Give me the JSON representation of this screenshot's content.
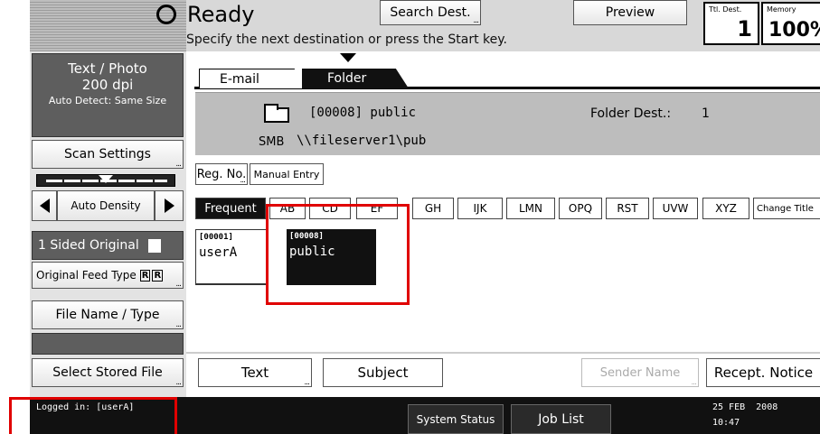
{
  "header": {
    "status_label": "Ready",
    "instruction": "Specify the next destination or press the Start key.",
    "search_dest_label": "Search Dest.",
    "preview_label": "Preview",
    "ttl_dest_label": "Ttl. Dest.",
    "ttl_dest_value": "1",
    "memory_label": "Memory",
    "memory_value": "100%"
  },
  "left_panel": {
    "mode_line1": "Text / Photo",
    "mode_line2": "200 dpi",
    "mode_line3": "Auto Detect: Same Size",
    "scan_settings": "Scan Settings",
    "density_label": "Auto Density",
    "original_sides": "1 Sided Original",
    "feed_type": "Original Feed Type",
    "file_name_type": "File Name / Type",
    "select_stored_file": "Select Stored File"
  },
  "tabs": [
    {
      "label": "E-mail",
      "active": false
    },
    {
      "label": "Folder",
      "active": true
    }
  ],
  "destination": {
    "folder_entry": "[00008] public",
    "protocol": "SMB",
    "path": "\\\\fileserver1\\pub",
    "folder_dest_label": "Folder Dest.:",
    "folder_dest_count": "1"
  },
  "entry_buttons": {
    "reg_no": "Reg. No.",
    "manual_entry": "Manual Entry"
  },
  "index_keys": [
    "Frequent",
    "AB",
    "CD",
    "EF",
    "GH",
    "IJK",
    "LMN",
    "OPQ",
    "RST",
    "UVW",
    "XYZ",
    "Change Title"
  ],
  "destinations": [
    {
      "number": "[00001]",
      "name": "userA",
      "selected": false
    },
    {
      "number": "[00008]",
      "name": "public",
      "selected": true
    }
  ],
  "bottom_buttons": {
    "text": "Text",
    "subject": "Subject",
    "sender_name": "Sender Name",
    "recept_notice": "Recept. Notice"
  },
  "status_bar": {
    "logged_in": "Logged in: [userA]",
    "system_status": "System Status",
    "job_list": "Job List",
    "date": "25 FEB  2008",
    "time": "10:47"
  },
  "colors": {
    "highlight_box": "#e00000",
    "selected_bg": "#111111",
    "status_bar": "#111111"
  }
}
